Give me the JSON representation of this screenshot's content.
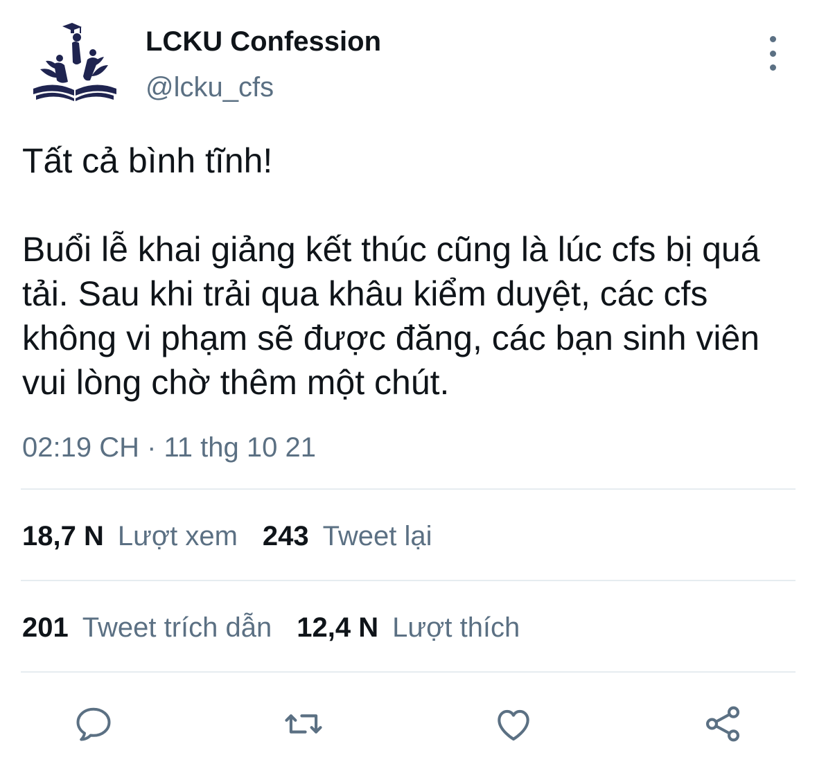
{
  "account": {
    "name": "LCKU Confession",
    "handle": "@lcku_cfs",
    "avatar_color": "#1f2450"
  },
  "tweet": {
    "paragraph1": "Tất cả bình tĩnh!",
    "paragraph2": "Buổi lễ khai giảng kết thúc cũng là lúc cfs bị quá tải. Sau khi trải qua khâu kiểm duyệt, các cfs không vi phạm sẽ được đăng, các bạn sinh viên vui lòng chờ thêm một chút.",
    "timestamp": "02:19 CH · 11 thg 10 21"
  },
  "stats": {
    "views_count": "18,7 N",
    "views_label": "Lượt xem",
    "retweets_count": "243",
    "retweets_label": "Tweet lại",
    "quotes_count": "201",
    "quotes_label": "Tweet trích dẫn",
    "likes_count": "12,4 N",
    "likes_label": "Lượt thích"
  },
  "actions": {
    "reply_icon": "comment-icon",
    "retweet_icon": "retweet-icon",
    "like_icon": "heart-icon",
    "share_icon": "share-icon"
  },
  "colors": {
    "text_primary": "#0f1419",
    "text_secondary": "#5b7083",
    "divider": "#e6ecf0"
  }
}
